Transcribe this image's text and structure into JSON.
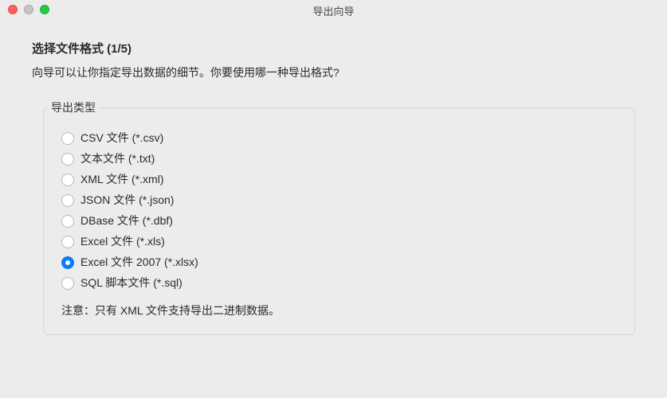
{
  "window": {
    "title": "导出向导"
  },
  "wizard": {
    "step_title": "选择文件格式 (1/5)",
    "description": "向导可以让你指定导出数据的细节。你要使用哪一种导出格式?",
    "group_label": "导出类型",
    "options": [
      {
        "label": "CSV 文件 (*.csv)",
        "selected": false
      },
      {
        "label": "文本文件 (*.txt)",
        "selected": false
      },
      {
        "label": "XML 文件 (*.xml)",
        "selected": false
      },
      {
        "label": "JSON 文件 (*.json)",
        "selected": false
      },
      {
        "label": "DBase 文件 (*.dbf)",
        "selected": false
      },
      {
        "label": "Excel 文件 (*.xls)",
        "selected": false
      },
      {
        "label": "Excel 文件 2007 (*.xlsx)",
        "selected": true
      },
      {
        "label": "SQL 脚本文件 (*.sql)",
        "selected": false
      }
    ],
    "note": "注意：只有 XML 文件支持导出二进制数据。"
  }
}
